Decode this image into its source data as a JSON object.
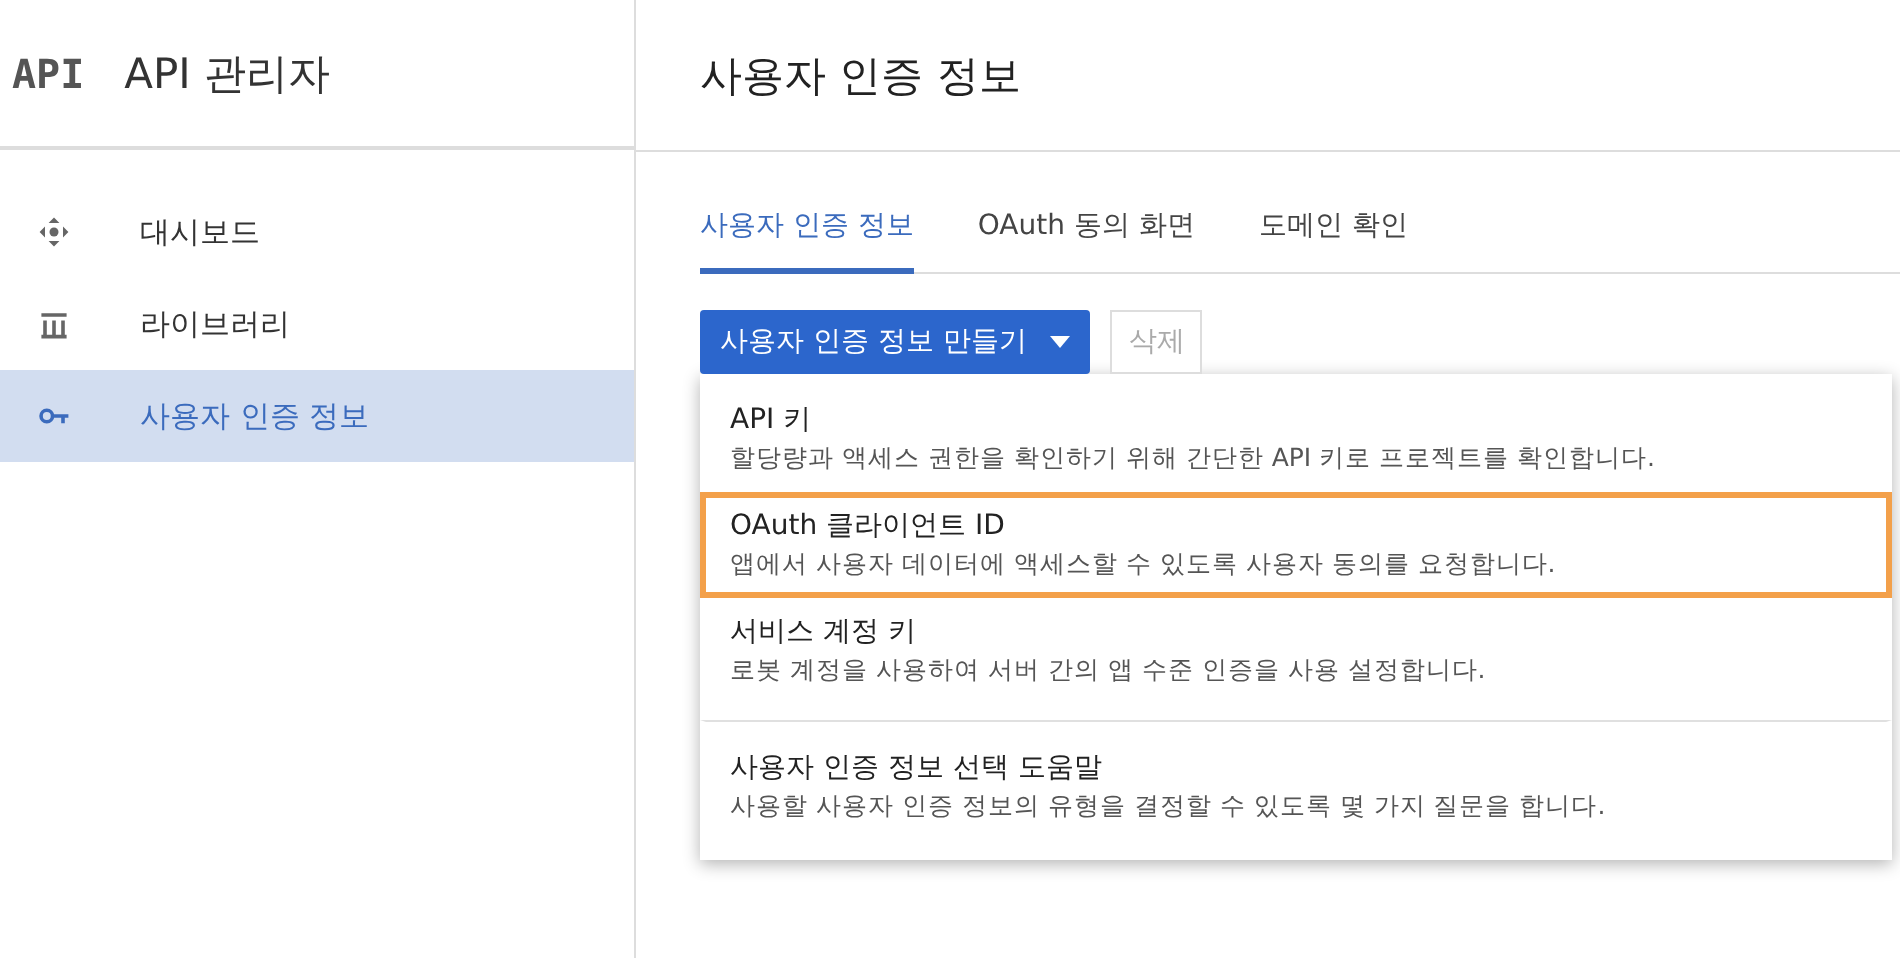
{
  "sidebar": {
    "logo": "API",
    "title": "API 관리자",
    "items": [
      {
        "label": "대시보드",
        "kind": "dashboard",
        "selected": false
      },
      {
        "label": "라이브러리",
        "kind": "library",
        "selected": false
      },
      {
        "label": "사용자 인증 정보",
        "kind": "key",
        "selected": true
      }
    ]
  },
  "page_title": "사용자 인증 정보",
  "tabs": [
    {
      "label": "사용자 인증 정보",
      "selected": true
    },
    {
      "label": "OAuth 동의 화면",
      "selected": false
    },
    {
      "label": "도메인 확인",
      "selected": false
    }
  ],
  "create_button": {
    "label": "사용자 인증 정보 만들기"
  },
  "delete_button": {
    "label": "삭제",
    "disabled": true
  },
  "menu": [
    {
      "kind": "option",
      "title": "API 키",
      "description": "할당량과 액세스 권한을 확인하기 위해 간단한 API 키로 프로젝트를 확인합니다.",
      "highlighted": false
    },
    {
      "kind": "option",
      "title": "OAuth 클라이언트 ID",
      "description": "앱에서 사용자 데이터에 액세스할 수 있도록 사용자 동의를 요청합니다.",
      "highlighted": true
    },
    {
      "kind": "option",
      "title": "서비스 계정 키",
      "description": "로봇 계정을 사용하여 서버 간의 앱 수준 인증을 사용 설정합니다.",
      "highlighted": false
    },
    {
      "kind": "help",
      "title": "사용자 인증 정보 선택 도움말",
      "description": "사용할 사용자 인증 정보의 유형을 결정할 수 있도록 몇 가지 질문을 합니다.",
      "highlighted": false
    }
  ]
}
